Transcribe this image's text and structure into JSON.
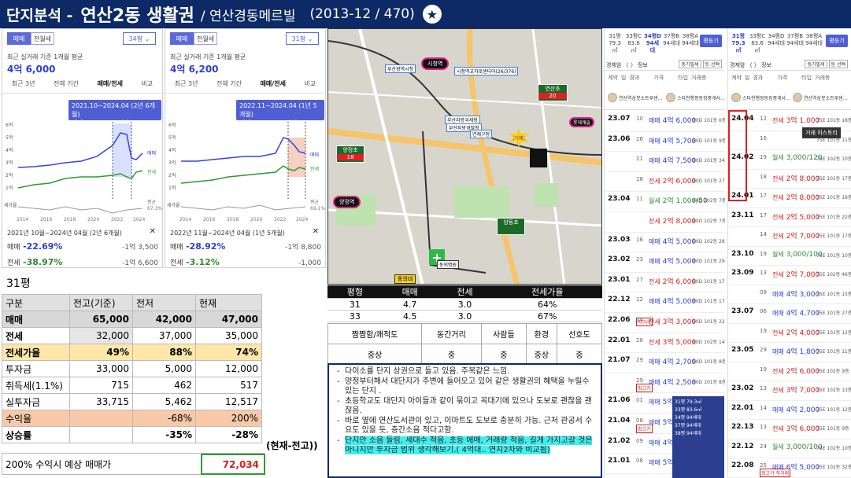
{
  "header": {
    "prefix": "단지분석 -",
    "region": "연산2동 생활권",
    "complex": "/ 연산경동메르빌",
    "meta": "(2013-12 / 470)",
    "star": "★"
  },
  "panel_left": {
    "tab_trade": "매매",
    "tab_rent": "전월세",
    "size_select": "34평 ⌄",
    "subtitle": "최근 실거래 기준 1개월 평균",
    "price": "4억 6,000",
    "periods": [
      "최근 3년",
      "전체 기간",
      "매매/전세",
      "비교"
    ],
    "tooltip_l1": "2021.10~2024.04 (2년 6개월)",
    "tooltip_l2": "매매 -22.69% / 전세 -38.97%",
    "yticks": [
      "6억",
      "5억",
      "4억",
      "3억",
      "2억",
      "1억",
      "세가율"
    ],
    "xticks": [
      "2014",
      "2016",
      "2018",
      "2020",
      "2022",
      "2024"
    ],
    "legend_trade": "매매",
    "legend_rent": "전세",
    "legend_avg": "평균",
    "legend_pct": "67.3%",
    "range": "2021년 10월~2024년 04월 (2년 6개월)",
    "close": "✕",
    "trade_label": "매매",
    "trade_pct": "-22.69%",
    "trade_diff": "-1억 3,500",
    "rent_label": "전세",
    "rent_pct": "-38.97%",
    "rent_diff": "-1억 6,600"
  },
  "panel_right": {
    "tab_trade": "매매",
    "tab_rent": "전월세",
    "size_select": "31평 ⌄",
    "subtitle": "최근 실거래 기준 1개월 평균",
    "price": "4억 6,200",
    "periods": [
      "최근 3년",
      "전체 기간",
      "매매/전세",
      "비교"
    ],
    "tooltip_l1": "2022.11~2024.04 (1년 5개월)",
    "tooltip_l2": "매매 -28.92% / 전세 -3.12%",
    "yticks": [
      "6억",
      "5억",
      "4억",
      "3억",
      "2억",
      "1억",
      "세가율"
    ],
    "xticks": [
      "2014",
      "2016",
      "2018",
      "2020",
      "2022",
      "2024"
    ],
    "legend_trade": "매매",
    "legend_rent": "전세",
    "legend_avg": "평균",
    "legend_pct": "69.1%",
    "range": "2022년 11월~2024년 04월 (1년 5개월)",
    "close": "✕",
    "trade_label": "매매",
    "trade_pct": "-28.92%",
    "trade_diff": "-1억 8,800",
    "rent_label": "전세",
    "rent_pct": "-3.12%",
    "rent_diff": "-1,000"
  },
  "map": {
    "labels": [
      "시청역",
      "부산광역시청",
      "시청역교차로센터아(26/376)",
      "연산초",
      "부산지방국세청",
      "부산지방경찰청",
      "연제구청",
      "롯데캐슬",
      "여기예요",
      "양정초",
      "양정역",
      "양동초",
      "동의대",
      "동의병원"
    ],
    "scores": [
      "20",
      "18"
    ]
  },
  "calc": {
    "title": "31평",
    "headers": [
      "구분",
      "전고(기준)",
      "전저",
      "현재"
    ],
    "rows": [
      {
        "label": "매매",
        "a": "65,000",
        "b": "42,000",
        "c": "47,000"
      },
      {
        "label": "전세",
        "a": "32,000",
        "b": "37,000",
        "c": "35,000"
      },
      {
        "label": "전세가율",
        "a": "49%",
        "b": "88%",
        "c": "74%"
      },
      {
        "label": "투자금",
        "a": "33,000",
        "b": "5,000",
        "c": "12,000"
      },
      {
        "label": "취득세(1.1%)",
        "a": "715",
        "b": "462",
        "c": "517"
      },
      {
        "label": "실투자금",
        "a": "33,715",
        "b": "5,462",
        "c": "12,517"
      },
      {
        "label": "수익율",
        "a": "",
        "b": "-68%",
        "c": "200%"
      },
      {
        "label": "상승률",
        "a": "",
        "b": "-35%",
        "c": "-28%"
      }
    ],
    "note": "(현재-전고))",
    "foot_label": "200% 수익시 예상 매매가",
    "foot_value": "72,034"
  },
  "ratio": {
    "headers": [
      "평형",
      "매매",
      "전세",
      "전세가율"
    ],
    "rows": [
      [
        "31",
        "4.7",
        "3.0",
        "64%"
      ],
      [
        "33",
        "4.5",
        "3.0",
        "67%"
      ]
    ]
  },
  "rating": {
    "headers": [
      "짬짬함/쾌적도",
      "동간거리",
      "사람들",
      "환경",
      "선호도"
    ],
    "values": [
      "중상",
      "중",
      "중",
      "중상",
      "중"
    ]
  },
  "notes": [
    "다이소를 단지 상권으로 들고 있음. 주복같은 느낌.",
    "양정부터해서 대단지가 주변에 들어오고 있어 같은 생활권의 혜택을 누릴수 있는 단지 .",
    "초등학교도 대단지 아이들과 같이 묶이고 꼭대기에 있으나 도보로 괜찮을 괜찮음.",
    "바로 옆에 연산도서관이 있고, 이마트도 도보로 충분히 가능. 근처 관공서 수요도 있을 듯, 층간소음 적다고함.",
    "단지안 소음 들림, 세대수 적음, 초등 애매, 거래량 적음, 길게 가지고갈 것은 아니지만 투자금 범위 생각해보기.( 4억대.. 연지2차와 비교됨)"
  ],
  "tx_left": {
    "tabs": [
      "31평\n79.3㎡",
      "33평C\n83.6㎡",
      "34평D\n94세대",
      "37평B\n94세대",
      "38평A\n94세대"
    ],
    "btn": "평등기",
    "head": "경제암 〈 〉 정보",
    "head_btns": [
      "동기필세",
      "등 선택"
    ],
    "cols": [
      "계약",
      "일",
      "경과",
      "가격",
      "타입",
      "거래층"
    ],
    "agent1": "연산역삼붓소트루센...",
    "agent2": "스타천행정동킹중개사...",
    "rows": [
      {
        "date": "23.07",
        "dd": "10",
        "kind": "매매",
        "price": "4억 6,000",
        "rest": "80D 101동 6층",
        "cls": "blue"
      },
      {
        "date": "23.06",
        "dd": "26",
        "kind": "매매",
        "price": "4억 5,700",
        "rest": "80D 101동 9층",
        "cls": "blue"
      },
      {
        "date": "",
        "dd": "21",
        "kind": "매매",
        "price": "4억 7,500",
        "rest": "80D 101동 34층",
        "cls": "blue"
      },
      {
        "date": "",
        "dd": "18",
        "kind": "전세",
        "price": "2억 6,000",
        "rest": "80D 101동 27층",
        "cls": "red"
      },
      {
        "date": "23.04",
        "dd": "11",
        "kind": "월세",
        "price": "2억 1,000/50",
        "rest": "80D 102동 7층",
        "cls": "green"
      },
      {
        "date": "",
        "dd": "",
        "kind": "전세",
        "price": "2억 8,000",
        "rest": "80D 102동 7층",
        "cls": "red"
      },
      {
        "date": "23.03",
        "dd": "16",
        "kind": "매매",
        "price": "4억 5,000",
        "rest": "80D 102동 28층",
        "cls": "blue"
      },
      {
        "date": "23.02",
        "dd": "23",
        "kind": "매매",
        "price": "4억 5,000",
        "rest": "80D 101동 29층",
        "cls": "blue"
      },
      {
        "date": "23.01",
        "dd": "27",
        "kind": "전세",
        "price": "2억 6,000",
        "rest": "80D 101동 17층",
        "cls": "red"
      },
      {
        "date": "22.12",
        "dd": "12",
        "kind": "매매",
        "price": "4억 5,000",
        "rest": "80D 101동 17층",
        "cls": "blue"
      },
      {
        "date": "22.06",
        "dd": "04",
        "kind": "전세",
        "price": "3억 3,000",
        "rest": "80D 101동 22층",
        "cls": "red"
      },
      {
        "date": "22.01",
        "dd": "28",
        "kind": "전세",
        "price": "3억 5,000",
        "rest": "80D 102동 14층",
        "cls": "red"
      },
      {
        "date": "21.07",
        "dd": "29",
        "kind": "매매",
        "price": "4억 2,700",
        "rest": "80D 101동 8층",
        "cls": "blue"
      },
      {
        "date": "",
        "dd": "29",
        "kind": "매매",
        "price": "4억 2,500",
        "rest": "80D 101동 8층",
        "cls": "blue"
      },
      {
        "date": "21.06",
        "dd": "01",
        "kind": "매매",
        "price": "5억 0,0",
        "rest": "",
        "cls": "blue"
      },
      {
        "date": "21.04",
        "dd": "08",
        "kind": "매매",
        "price": "5억 8,8",
        "rest": "",
        "cls": "blue"
      },
      {
        "date": "21.02",
        "dd": "09",
        "kind": "매매",
        "price": "4억 5,0",
        "rest": "",
        "cls": "blue"
      },
      {
        "date": "21.01",
        "dd": "08",
        "kind": "매매",
        "price": "5억 1,5",
        "rest": "",
        "cls": "blue"
      }
    ],
    "tags": [
      "직거래",
      "최고가",
      "최고가"
    ],
    "popup": [
      "31평 79.3㎡",
      "33평 83.6㎡",
      "34평 94세대",
      "37평 94세대",
      "38평 94세대"
    ]
  },
  "tx_right": {
    "tabs": [
      "31평\n79.3㎡",
      "33평C\n83.6㎡",
      "34평D\n94세대",
      "37평B\n94세대",
      "38평A\n94세대"
    ],
    "btn": "평등기",
    "head": "경제암 〈 〉 정보",
    "head_btns": [
      "동기필세",
      "등 선택"
    ],
    "cols": [
      "계약",
      "일",
      "경과",
      "가격",
      "타입",
      "거래층"
    ],
    "agent1": "스타천행정동킹중개사...",
    "agent2": "연산역삼붓소트루센...",
    "tooltip": "거래 히스토리",
    "rows": [
      {
        "date": "24.04",
        "dd": "12",
        "kind": "전세",
        "price": "3억 1,000",
        "rest": "75E 101동 18층",
        "cls": "red"
      },
      {
        "date": "",
        "dd": "16",
        "kind": "",
        "price": "",
        "rest": "75E 101동 11층",
        "cls": "red"
      },
      {
        "date": "24.02",
        "dd": "19",
        "kind": "월세",
        "price": "3,000/120",
        "rest": "75E 102동 10층",
        "cls": "green"
      },
      {
        "date": "",
        "dd": "18",
        "kind": "전세",
        "price": "2억 8,000",
        "rest": "75E 101동 17층",
        "cls": "red"
      },
      {
        "date": "24.01",
        "dd": "17",
        "kind": "전세",
        "price": "2억 8,000",
        "rest": "75E 101동 18층",
        "cls": "red"
      },
      {
        "date": "23.11",
        "dd": "17",
        "kind": "전세",
        "price": "2억 5,000",
        "rest": "75E 101동 22층",
        "cls": "red"
      },
      {
        "date": "",
        "dd": "14",
        "kind": "전세",
        "price": "2억 7,000",
        "rest": "75E 101동 17층",
        "cls": "red"
      },
      {
        "date": "23.10",
        "dd": "19",
        "kind": "월세",
        "price": "3,000/100",
        "rest": "75E 101동 10층",
        "cls": "green"
      },
      {
        "date": "23.09",
        "dd": "13",
        "kind": "전세",
        "price": "2억 7,000",
        "rest": "75E 102동 46층",
        "cls": "red"
      },
      {
        "date": "",
        "dd": "09",
        "kind": "매매",
        "price": "4억 3,000",
        "rest": "75E 101동 15층",
        "cls": "blue"
      },
      {
        "date": "23.07",
        "dd": "06",
        "kind": "매매",
        "price": "4억 4,700",
        "rest": "75E 101동 27층",
        "cls": "blue"
      },
      {
        "date": "",
        "dd": "19",
        "kind": "전세",
        "price": "2억 4,000",
        "rest": "75E 102동 12층",
        "cls": "red"
      },
      {
        "date": "23.05",
        "dd": "29",
        "kind": "매매",
        "price": "4억 1,800",
        "rest": "75E 101동 11층",
        "cls": "blue"
      },
      {
        "date": "",
        "dd": "19",
        "kind": "전세",
        "price": "2억 6,000",
        "rest": "75E 102동 9층",
        "cls": "red"
      },
      {
        "date": "23.02",
        "dd": "13",
        "kind": "전세",
        "price": "3억 7,000",
        "rest": "75E 102동 13층",
        "cls": "red"
      },
      {
        "date": "22.01",
        "dd": "14",
        "kind": "매매",
        "price": "4억 2,000",
        "rest": "75E 101동 12층",
        "cls": "blue"
      },
      {
        "date": "22.13",
        "dd": "13",
        "kind": "전세",
        "price": "3억 6,000",
        "rest": "75E 101동 9층",
        "cls": "red"
      },
      {
        "date": "22.12",
        "dd": "24",
        "kind": "월세",
        "price": "3,000/100",
        "rest": "75E 102동 10층",
        "cls": "green"
      },
      {
        "date": "22.08",
        "dd": "25",
        "kind": "매매",
        "price": "6억 5,000",
        "rest": "75E 102동 32층",
        "cls": "blue"
      }
    ],
    "tag": "최고가 직거래"
  }
}
